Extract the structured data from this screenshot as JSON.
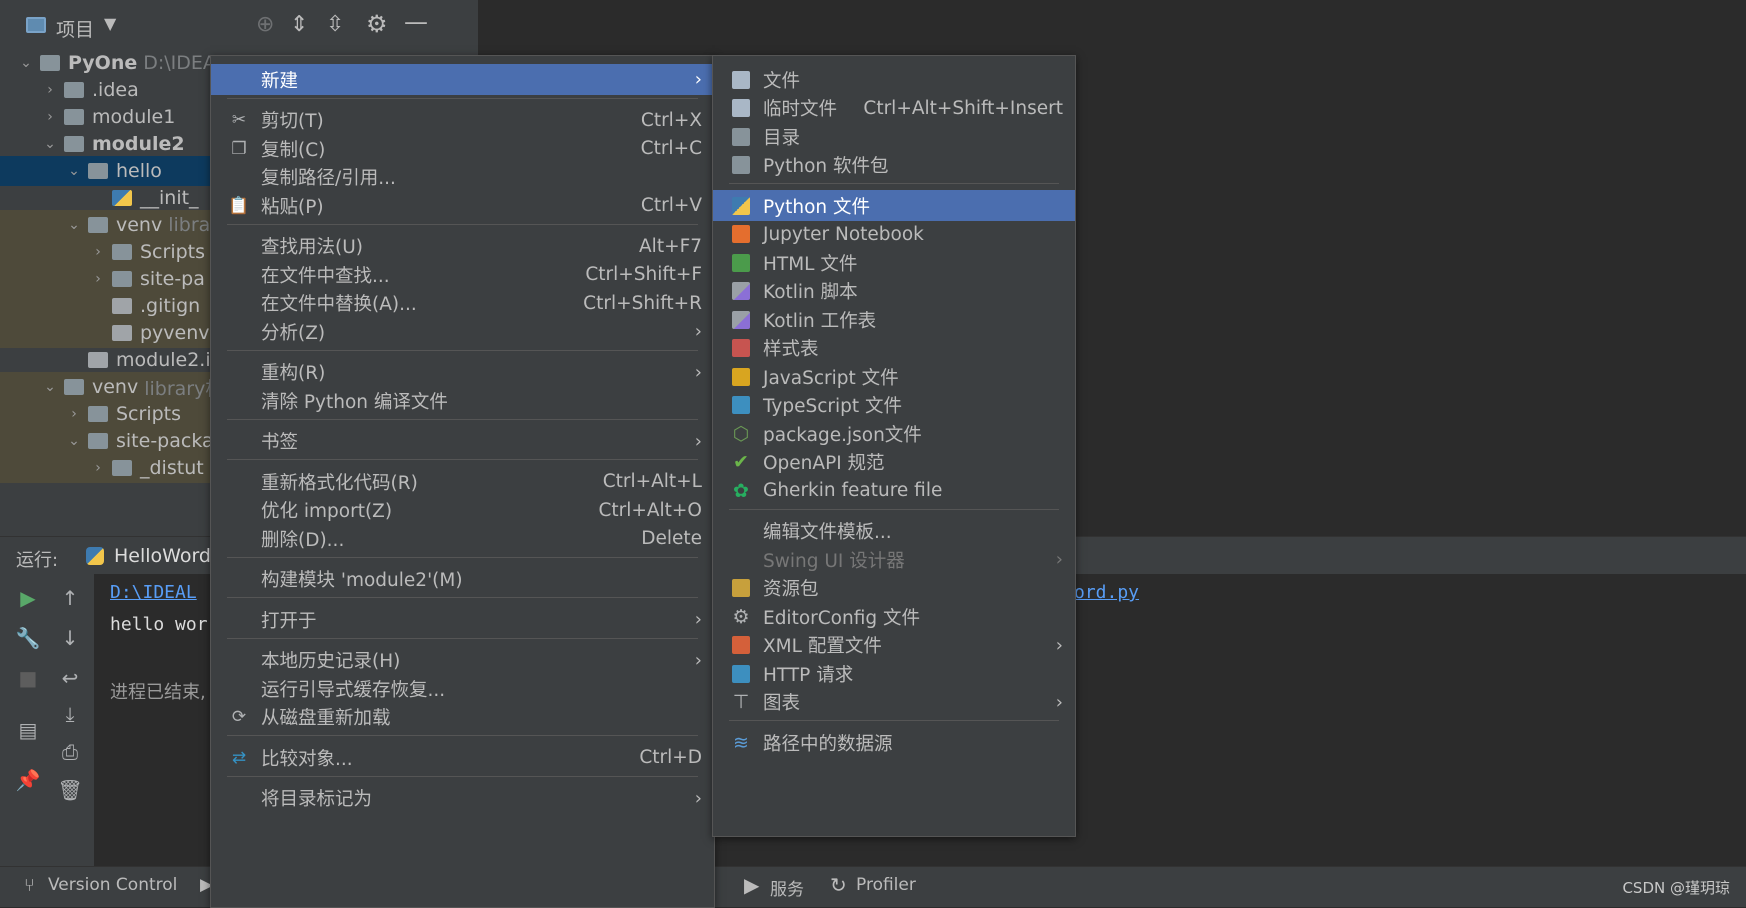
{
  "project_panel": {
    "title": "项目",
    "tree": [
      {
        "label": "PyOne",
        "hint": "D:\\IDEA\\",
        "indent": 0,
        "expanded": true,
        "bold": true,
        "icon": "project-folder-icon"
      },
      {
        "label": ".idea",
        "indent": 1,
        "expanded": false,
        "icon": "folder-icon"
      },
      {
        "label": "module1",
        "indent": 1,
        "expanded": false,
        "icon": "folder-icon"
      },
      {
        "label": "module2",
        "indent": 1,
        "expanded": true,
        "bold": true,
        "icon": "module-folder-icon"
      },
      {
        "label": "hello",
        "indent": 2,
        "expanded": true,
        "selected": true,
        "icon": "package-icon"
      },
      {
        "label": "__init_",
        "indent": 3,
        "icon": "python-file-icon"
      },
      {
        "label": "venv",
        "hint": "libra",
        "indent": 2,
        "expanded": true,
        "library": true,
        "icon": "folder-icon"
      },
      {
        "label": "Scripts",
        "indent": 3,
        "expanded": false,
        "library": true,
        "icon": "folder-icon"
      },
      {
        "label": "site-pa",
        "indent": 3,
        "expanded": false,
        "library": true,
        "icon": "folder-icon"
      },
      {
        "label": ".gitign",
        "indent": 3,
        "library": true,
        "icon": "gitignore-file-icon"
      },
      {
        "label": "pyvenv",
        "indent": 3,
        "library": true,
        "icon": "text-file-icon"
      },
      {
        "label": "module2.i",
        "indent": 2,
        "icon": "iml-file-icon"
      },
      {
        "label": "venv",
        "hint": "library根",
        "indent": 1,
        "expanded": true,
        "library": true,
        "icon": "folder-icon"
      },
      {
        "label": "Scripts",
        "indent": 2,
        "expanded": false,
        "library": true,
        "icon": "folder-icon"
      },
      {
        "label": "site-packa",
        "indent": 2,
        "expanded": true,
        "library": true,
        "icon": "folder-icon"
      },
      {
        "label": "_distut",
        "indent": 3,
        "expanded": false,
        "library": true,
        "icon": "folder-icon"
      }
    ]
  },
  "run_panel": {
    "label": "运行:",
    "tab": "HelloWord",
    "output": [
      "D:\\IDEAL",
      "hello wor",
      "进程已结束,"
    ],
    "link_tail": "ord.py"
  },
  "status_bar": {
    "items": [
      "Version Control",
      "服务",
      "Profiler"
    ],
    "watermark": "CSDN @瑾玥琼"
  },
  "context_menu": [
    {
      "label": "新建",
      "submenu": true,
      "highlighted": true
    },
    {
      "sep": true
    },
    {
      "label": "剪切(T)",
      "shortcut": "Ctrl+X",
      "icon": "scissors-icon"
    },
    {
      "label": "复制(C)",
      "shortcut": "Ctrl+C",
      "icon": "copy-icon"
    },
    {
      "label": "复制路径/引用..."
    },
    {
      "label": "粘贴(P)",
      "shortcut": "Ctrl+V",
      "icon": "paste-icon"
    },
    {
      "sep": true
    },
    {
      "label": "查找用法(U)",
      "shortcut": "Alt+F7"
    },
    {
      "label": "在文件中查找...",
      "shortcut": "Ctrl+Shift+F"
    },
    {
      "label": "在文件中替换(A)...",
      "shortcut": "Ctrl+Shift+R"
    },
    {
      "label": "分析(Z)",
      "submenu": true
    },
    {
      "sep": true
    },
    {
      "label": "重构(R)",
      "submenu": true
    },
    {
      "label": "清除 Python 编译文件"
    },
    {
      "sep": true
    },
    {
      "label": "书签",
      "submenu": true
    },
    {
      "sep": true
    },
    {
      "label": "重新格式化代码(R)",
      "shortcut": "Ctrl+Alt+L"
    },
    {
      "label": "优化 import(Z)",
      "shortcut": "Ctrl+Alt+O"
    },
    {
      "label": "删除(D)...",
      "shortcut": "Delete"
    },
    {
      "sep": true
    },
    {
      "label": "构建模块 'module2'(M)"
    },
    {
      "sep": true
    },
    {
      "label": "打开于",
      "submenu": true
    },
    {
      "sep": true
    },
    {
      "label": "本地历史记录(H)",
      "submenu": true
    },
    {
      "label": "运行引导式缓存恢复..."
    },
    {
      "label": "从磁盘重新加载",
      "icon": "reload-icon"
    },
    {
      "sep": true
    },
    {
      "label": "比较对象...",
      "shortcut": "Ctrl+D",
      "icon": "compare-icon"
    },
    {
      "sep": true
    },
    {
      "label": "将目录标记为",
      "submenu": true
    }
  ],
  "new_submenu": [
    {
      "label": "文件",
      "icon": "file-icon",
      "color": "#a9b7c6"
    },
    {
      "label": "临时文件",
      "shortcut": "Ctrl+Alt+Shift+Insert",
      "icon": "scratch-file-icon",
      "color": "#a9b7c6"
    },
    {
      "label": "目录",
      "icon": "directory-icon",
      "color": "#87939a"
    },
    {
      "label": "Python 软件包",
      "icon": "python-package-icon",
      "color": "#87939a"
    },
    {
      "sep": true
    },
    {
      "label": "Python 文件",
      "icon": "python-file-icon",
      "color": "#3e7bb0",
      "highlighted": true
    },
    {
      "label": "Jupyter Notebook",
      "icon": "jupyter-icon",
      "color": "#e46e2e"
    },
    {
      "label": "HTML 文件",
      "icon": "html-file-icon",
      "color": "#4b9b4b"
    },
    {
      "label": "Kotlin 脚本",
      "icon": "kotlin-script-icon",
      "color": "#8b6fd6"
    },
    {
      "label": "Kotlin 工作表",
      "icon": "kotlin-worksheet-icon",
      "color": "#8b6fd6"
    },
    {
      "label": "样式表",
      "icon": "css-file-icon",
      "color": "#c75450"
    },
    {
      "label": "JavaScript 文件",
      "icon": "javascript-file-icon",
      "color": "#d8a520"
    },
    {
      "label": "TypeScript 文件",
      "icon": "typescript-file-icon",
      "color": "#3d8fbf"
    },
    {
      "label": "package.json文件",
      "icon": "nodejs-icon",
      "color": "#6a9955"
    },
    {
      "label": "OpenAPI 规范",
      "icon": "openapi-icon",
      "color": "#6bb54a"
    },
    {
      "label": "Gherkin feature file",
      "icon": "gherkin-icon",
      "color": "#27ae60"
    },
    {
      "sep": true
    },
    {
      "label": "编辑文件模板...",
      "icon": "none"
    },
    {
      "label": "Swing UI 设计器",
      "submenu": true,
      "disabled": true,
      "icon": "none"
    },
    {
      "label": "资源包",
      "icon": "resource-bundle-icon",
      "color": "#c7a03c"
    },
    {
      "label": "EditorConfig 文件",
      "icon": "gear-icon",
      "color": "#afb1b3"
    },
    {
      "label": "XML 配置文件",
      "submenu": true,
      "icon": "xml-file-icon",
      "color": "#d4603a"
    },
    {
      "label": "HTTP 请求",
      "icon": "http-api-icon",
      "color": "#3d8fbf"
    },
    {
      "label": "图表",
      "submenu": true,
      "icon": "diagram-icon",
      "color": "#afb1b3"
    },
    {
      "sep": true
    },
    {
      "label": "路径中的数据源",
      "icon": "database-icon",
      "color": "#5b9bd5"
    }
  ]
}
